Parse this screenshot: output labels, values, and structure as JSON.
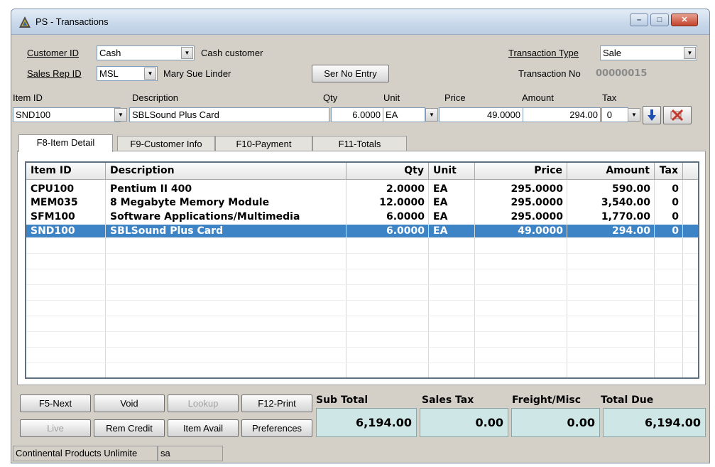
{
  "window": {
    "title": "PS - Transactions"
  },
  "header": {
    "customer_id_label": "Customer ID",
    "customer_id_value": "Cash",
    "customer_name": "Cash customer",
    "sales_rep_label": "Sales Rep ID",
    "sales_rep_value": "MSL",
    "sales_rep_name": "Mary Sue Linder",
    "ser_no_button": "Ser No Entry",
    "transaction_type_label": "Transaction Type",
    "transaction_type_value": "Sale",
    "transaction_no_label": "Transaction No",
    "transaction_no_value": "00000015"
  },
  "entry": {
    "item_id_label": "Item ID",
    "description_label": "Description",
    "qty_label": "Qty",
    "unit_label": "Unit",
    "price_label": "Price",
    "amount_label": "Amount",
    "tax_label": "Tax",
    "item_id_value": "SND100",
    "description_value": "SBLSound Plus Card",
    "qty_value": "6.0000",
    "unit_value": "EA",
    "price_value": "49.0000",
    "amount_value": "294.00",
    "tax_value": "0"
  },
  "tabs": [
    {
      "label": "F8-Item Detail"
    },
    {
      "label": "F9-Customer Info"
    },
    {
      "label": "F10-Payment"
    },
    {
      "label": "F11-Totals"
    }
  ],
  "grid": {
    "columns": [
      "Item ID",
      "Description",
      "Qty",
      "Unit",
      "Price",
      "Amount",
      "Tax"
    ],
    "rows": [
      {
        "item_id": "CPU100",
        "description": "Pentium II 400",
        "qty": "2.0000",
        "unit": "EA",
        "price": "295.0000",
        "amount": "590.00",
        "tax": "0"
      },
      {
        "item_id": "MEM035",
        "description": "8 Megabyte Memory Module",
        "qty": "12.0000",
        "unit": "EA",
        "price": "295.0000",
        "amount": "3,540.00",
        "tax": "0"
      },
      {
        "item_id": "SFM100",
        "description": "Software Applications/Multimedia",
        "qty": "6.0000",
        "unit": "EA",
        "price": "295.0000",
        "amount": "1,770.00",
        "tax": "0"
      },
      {
        "item_id": "SND100",
        "description": "SBLSound Plus Card",
        "qty": "6.0000",
        "unit": "EA",
        "price": "49.0000",
        "amount": "294.00",
        "tax": "0"
      }
    ],
    "selected_row": 4
  },
  "buttons": {
    "next": "F5-Next",
    "void": "Void",
    "lookup": "Lookup",
    "print": "F12-Print",
    "live": "Live",
    "rem_credit": "Rem Credit",
    "item_avail": "Item Avail",
    "preferences": "Preferences"
  },
  "totals": {
    "sub_total_label": "Sub Total",
    "sub_total_value": "6,194.00",
    "sales_tax_label": "Sales Tax",
    "sales_tax_value": "0.00",
    "freight_label": "Freight/Misc",
    "freight_value": "0.00",
    "total_due_label": "Total Due",
    "total_due_value": "6,194.00"
  },
  "status": {
    "company": "Continental Products Unlimite",
    "user": "sa"
  },
  "colors": {
    "selection": "#3d84c6",
    "totals_bg": "#cfe6e6",
    "down_arrow": "#1d4fb0",
    "delete_icon": "#c0392b"
  }
}
